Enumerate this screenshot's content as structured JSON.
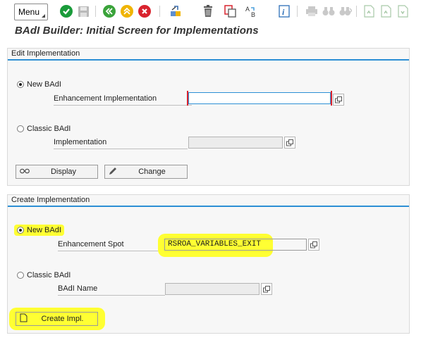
{
  "toolbar": {
    "menu_label": "Menu",
    "icons": [
      "check-icon",
      "save-icon",
      "back-icon",
      "exit-icon",
      "cancel-icon",
      "object-list-icon",
      "delete-icon",
      "copy-icon",
      "rename-icon",
      "info-icon",
      "print-icon",
      "find-icon",
      "find-next-icon",
      "first-page-icon",
      "previous-page-icon",
      "next-page-icon"
    ]
  },
  "page_title": "BAdI Builder: Initial Screen for Implementations",
  "edit_panel": {
    "title": "Edit Implementation",
    "new_badi_label": "New BAdI",
    "enh_impl_label": "Enhancement Implementation",
    "enh_impl_value": "",
    "classic_badi_label": "Classic BAdI",
    "implementation_label": "Implementation",
    "implementation_value": "",
    "display_label": "Display",
    "change_label": "Change",
    "selected": "new"
  },
  "create_panel": {
    "title": "Create Implementation",
    "new_badi_label": "New BAdI",
    "enh_spot_label": "Enhancement Spot",
    "enh_spot_value": "RSROA_VARIABLES_EXIT",
    "classic_badi_label": "Classic BAdI",
    "badi_name_label": "BAdI Name",
    "badi_name_value": "",
    "create_label": "Create Impl.",
    "selected": "new"
  },
  "colors": {
    "accent": "#2c8fd5",
    "highlight": "#ffff33",
    "ok_green": "#1a9b3a",
    "nav_green": "#3aa33a",
    "exit_yellow": "#f0b400",
    "cancel_red": "#d9232e"
  }
}
